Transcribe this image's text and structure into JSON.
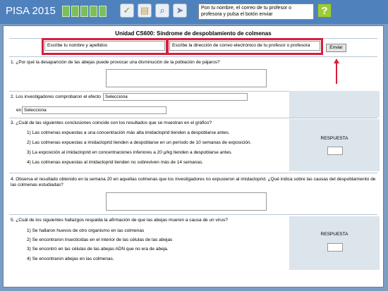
{
  "app": {
    "title": "PISA 2015",
    "progress_segments": 5
  },
  "toolbar": {
    "check_icon": "check-icon",
    "folder_icon": "folder-icon",
    "magnify_icon": "magnify-icon",
    "send_icon": "send-icon"
  },
  "instructions": "Pon tu nombre, el correo de tu profesor o profesora y pulsa el botón enviar",
  "unit_title": "Unidad CS600: Síndrome de despoblamiento de colmenas",
  "form": {
    "name_placeholder": "Escribe tu nombre y apellidos",
    "email_placeholder": "Escribe la dirección de correo electrónico de tu profesor o profesora",
    "send_label": "Enviar"
  },
  "q1": {
    "text": "1. ¿Por qué la desaparición de las abejas puede provocar una disminución de la población de pájaros?"
  },
  "q2": {
    "text": "2. Los investigadores comprobaron el efecto",
    "select1": "Selecciona",
    "prefix2": "en",
    "select2": "Selecciona"
  },
  "q3": {
    "text": "3. ¿Cuál de las siguientes conclusiones coincide con los resultados que se muestran en el gráfico?",
    "options": [
      "1) Las colmenas expuestas a una concentración más alta imidacloprid tienden a despoblarse antes.",
      "2) Las colmenas expuestas a imidacloprid tienden a despoblarse en un período de 10 semanas de exposición.",
      "3) La exposición al imidacloprid en concentraciones inferiores a 20 µ/kg tienden a despoblarse antes.",
      "4) Las colmenas expuestas al imidacloprid tienden no sobreviven más de 14 semanas."
    ],
    "response_label": "RESPUESTA"
  },
  "q4": {
    "text": "4. Observa el resultado obtenido en la semana 20 en aquellas colmenas que los investigadores no expusieron al imidacloprid. ¿Qué indica sobre las causas del despoblamiento de las colmenas estudiadas?"
  },
  "q5": {
    "text": "5. ¿Cuál de los siguientes hallazgos respalda la afirmación de que las abejas mueren a causa de un virus?",
    "options": [
      "1) Se hallaron huevos de otro organismo en las colmenas",
      "2) Se encontraron insecticidas en el interior de las células de las abejas",
      "3) Se encontró en las células de las abejas ADN que no era de abeja.",
      "4) Se encontraron abejas en las colmenas."
    ],
    "response_label": "RESPUESTA"
  },
  "colors": {
    "topbar": "#4f81bd",
    "background": "#7a9dc4",
    "highlight": "#d61f3b",
    "progress": "#7cbf5a",
    "help": "#9ccb3b"
  }
}
